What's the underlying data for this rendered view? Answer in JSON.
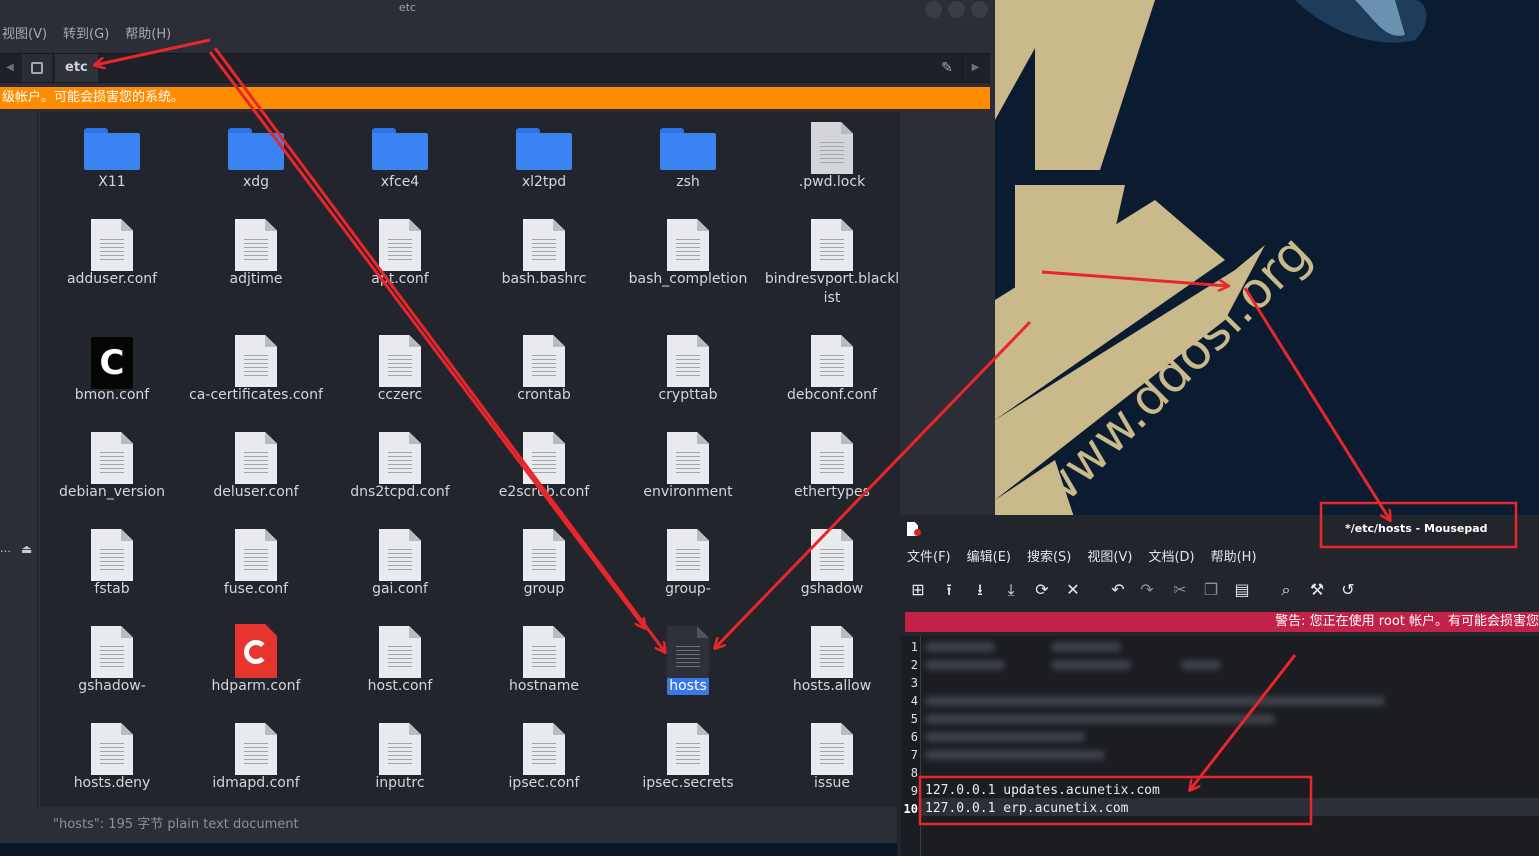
{
  "wallpaper": {
    "watermark": "www.ddosi.org",
    "colors": {
      "background": "#0b1c31",
      "shape": "#c9b98b"
    }
  },
  "file_manager": {
    "title": "etc",
    "menu": [
      "视图(V)",
      "转到(G)",
      "帮助(H)"
    ],
    "path_crumb": "etc",
    "warning": "级帐户。可能会损害您的系统。",
    "files": [
      {
        "name": "X11",
        "icon": "folder-icon"
      },
      {
        "name": "xdg",
        "icon": "folder-icon"
      },
      {
        "name": "xfce4",
        "icon": "folder-icon"
      },
      {
        "name": "xl2tpd",
        "icon": "folder-icon"
      },
      {
        "name": "zsh",
        "icon": "folder-icon"
      },
      {
        "name": ".pwd.lock",
        "icon": "document-icon"
      },
      {
        "name": "adduser.conf",
        "icon": "document-icon"
      },
      {
        "name": "adjtime",
        "icon": "document-icon"
      },
      {
        "name": "apt.conf",
        "icon": "document-icon"
      },
      {
        "name": "bash.bashrc",
        "icon": "document-icon"
      },
      {
        "name": "bash_completion",
        "icon": "document-icon"
      },
      {
        "name": "bindresvport.blacklist",
        "icon": "document-icon"
      },
      {
        "name": "bmon.conf",
        "icon": "c-source-icon"
      },
      {
        "name": "ca-certificates.conf",
        "icon": "document-icon"
      },
      {
        "name": "cczerc",
        "icon": "document-icon"
      },
      {
        "name": "crontab",
        "icon": "document-icon"
      },
      {
        "name": "crypttab",
        "icon": "document-icon"
      },
      {
        "name": "debconf.conf",
        "icon": "document-icon"
      },
      {
        "name": "debian_version",
        "icon": "document-icon"
      },
      {
        "name": "deluser.conf",
        "icon": "document-icon"
      },
      {
        "name": "dns2tcpd.conf",
        "icon": "document-icon"
      },
      {
        "name": "e2scrub.conf",
        "icon": "document-icon"
      },
      {
        "name": "environment",
        "icon": "document-icon"
      },
      {
        "name": "ethertypes",
        "icon": "document-icon"
      },
      {
        "name": "fstab",
        "icon": "document-icon"
      },
      {
        "name": "fuse.conf",
        "icon": "document-icon"
      },
      {
        "name": "gai.conf",
        "icon": "document-icon"
      },
      {
        "name": "group",
        "icon": "document-icon"
      },
      {
        "name": "group-",
        "icon": "document-icon"
      },
      {
        "name": "gshadow",
        "icon": "document-icon"
      },
      {
        "name": "gshadow-",
        "icon": "document-icon"
      },
      {
        "name": "hdparm.conf",
        "icon": "hdparm-icon"
      },
      {
        "name": "host.conf",
        "icon": "document-icon"
      },
      {
        "name": "hostname",
        "icon": "document-icon"
      },
      {
        "name": "hosts",
        "icon": "document-icon",
        "selected": true
      },
      {
        "name": "hosts.allow",
        "icon": "document-icon"
      },
      {
        "name": "hosts.deny",
        "icon": "document-icon"
      },
      {
        "name": "idmapd.conf",
        "icon": "document-icon"
      },
      {
        "name": "inputrc",
        "icon": "document-icon"
      },
      {
        "name": "ipsec.conf",
        "icon": "document-icon"
      },
      {
        "name": "ipsec.secrets",
        "icon": "document-icon"
      },
      {
        "name": "issue",
        "icon": "document-icon"
      }
    ],
    "status": "\"hosts\": 195 字节 plain text document",
    "colors": {
      "warning": "#ff8c00",
      "selection": "#3b78e7",
      "folder": "#3b83f2"
    }
  },
  "mousepad": {
    "title": "*/etc/hosts - Mousepad",
    "menu": [
      "文件(F)",
      "编辑(E)",
      "搜索(S)",
      "视图(V)",
      "文档(D)",
      "帮助(H)"
    ],
    "toolbar": [
      "new-document-icon",
      "open-icon",
      "save-icon",
      "save-as-icon",
      "reload-icon",
      "close-icon",
      "undo-icon",
      "redo-icon",
      "cut-icon",
      "copy-icon",
      "paste-icon",
      "find-icon",
      "find-replace-icon",
      "go-to-icon"
    ],
    "warning": "警告: 您正在使用 root 帐户。有可能会损害您",
    "line_numbers": [
      "1",
      "2",
      "3",
      "4",
      "5",
      "6",
      "7",
      "8",
      "9",
      "10"
    ],
    "lines": [
      {
        "num": "9",
        "text": "127.0.0.1 updates.acunetix.com"
      },
      {
        "num": "10",
        "text": "127.0.0.1 erp.acunetix.com"
      }
    ],
    "colors": {
      "warning": "#c2224a"
    }
  },
  "annotation_color": "#e8262b"
}
